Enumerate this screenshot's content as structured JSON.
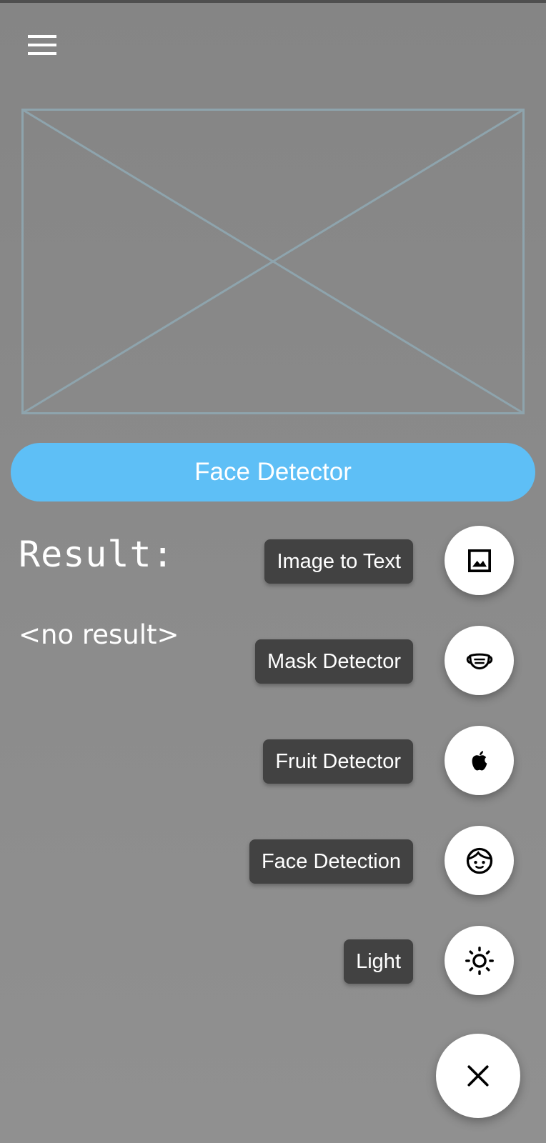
{
  "detect_button": {
    "label": "Face Detector"
  },
  "result": {
    "title": "Result:",
    "text": "<no result>"
  },
  "fab_menu": {
    "items": [
      {
        "label": "Image to Text",
        "icon": "image-icon"
      },
      {
        "label": "Mask Detector",
        "icon": "mask-icon"
      },
      {
        "label": "Fruit Detector",
        "icon": "apple-icon"
      },
      {
        "label": "Face Detection",
        "icon": "face-icon"
      },
      {
        "label": "Light",
        "icon": "sun-icon"
      }
    ],
    "main_icon": "close-icon"
  },
  "colors": {
    "accent": "#5ebff6",
    "label_background": "#424242",
    "placeholder_stroke": "#8ea4ad",
    "background": "#888888"
  }
}
